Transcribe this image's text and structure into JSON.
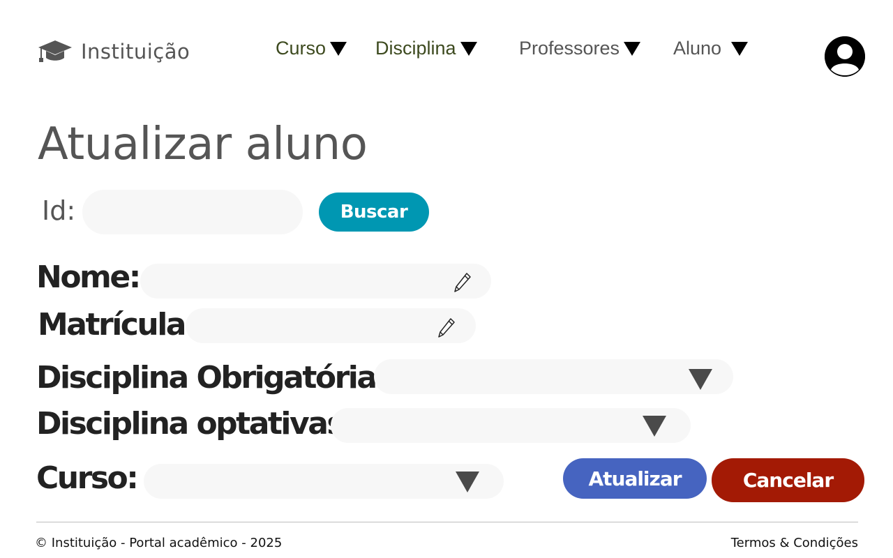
{
  "header": {
    "brand_name": "Instituição",
    "brand_icon": "graduation-cap-icon",
    "nav": [
      {
        "label": "Curso"
      },
      {
        "label": "Disciplina"
      },
      {
        "label": "Professores"
      },
      {
        "label": "Aluno"
      }
    ],
    "avatar_icon": "user-avatar-icon"
  },
  "main": {
    "title": "Atualizar aluno",
    "search": {
      "id_label": "Id:",
      "id_value": "",
      "button_label": "Buscar"
    },
    "form": {
      "nome_label": "Nome:",
      "nome_value": "",
      "matricula_label": "Matrícula:",
      "matricula_value": "",
      "disciplinas_obrigatorias_label": "Disciplina Obrigatórias:",
      "disciplinas_obrigatorias_value": "",
      "disciplinas_optativas_label": "Disciplina optativas:",
      "disciplinas_optativas_value": "",
      "curso_label": "Curso:",
      "curso_value": ""
    },
    "buttons": {
      "update_label": "Atualizar",
      "cancel_label": "Cancelar"
    }
  },
  "footer": {
    "copyright": "© Instituição - Portal acadêmico - 2025",
    "terms": "Termos & Condições"
  },
  "colors": {
    "buscar": "#0097b2",
    "atualizar": "#4664c0",
    "cancelar": "#a31a05",
    "nav_active": "#3d4a1f",
    "field_bg": "#f7f7f7"
  }
}
